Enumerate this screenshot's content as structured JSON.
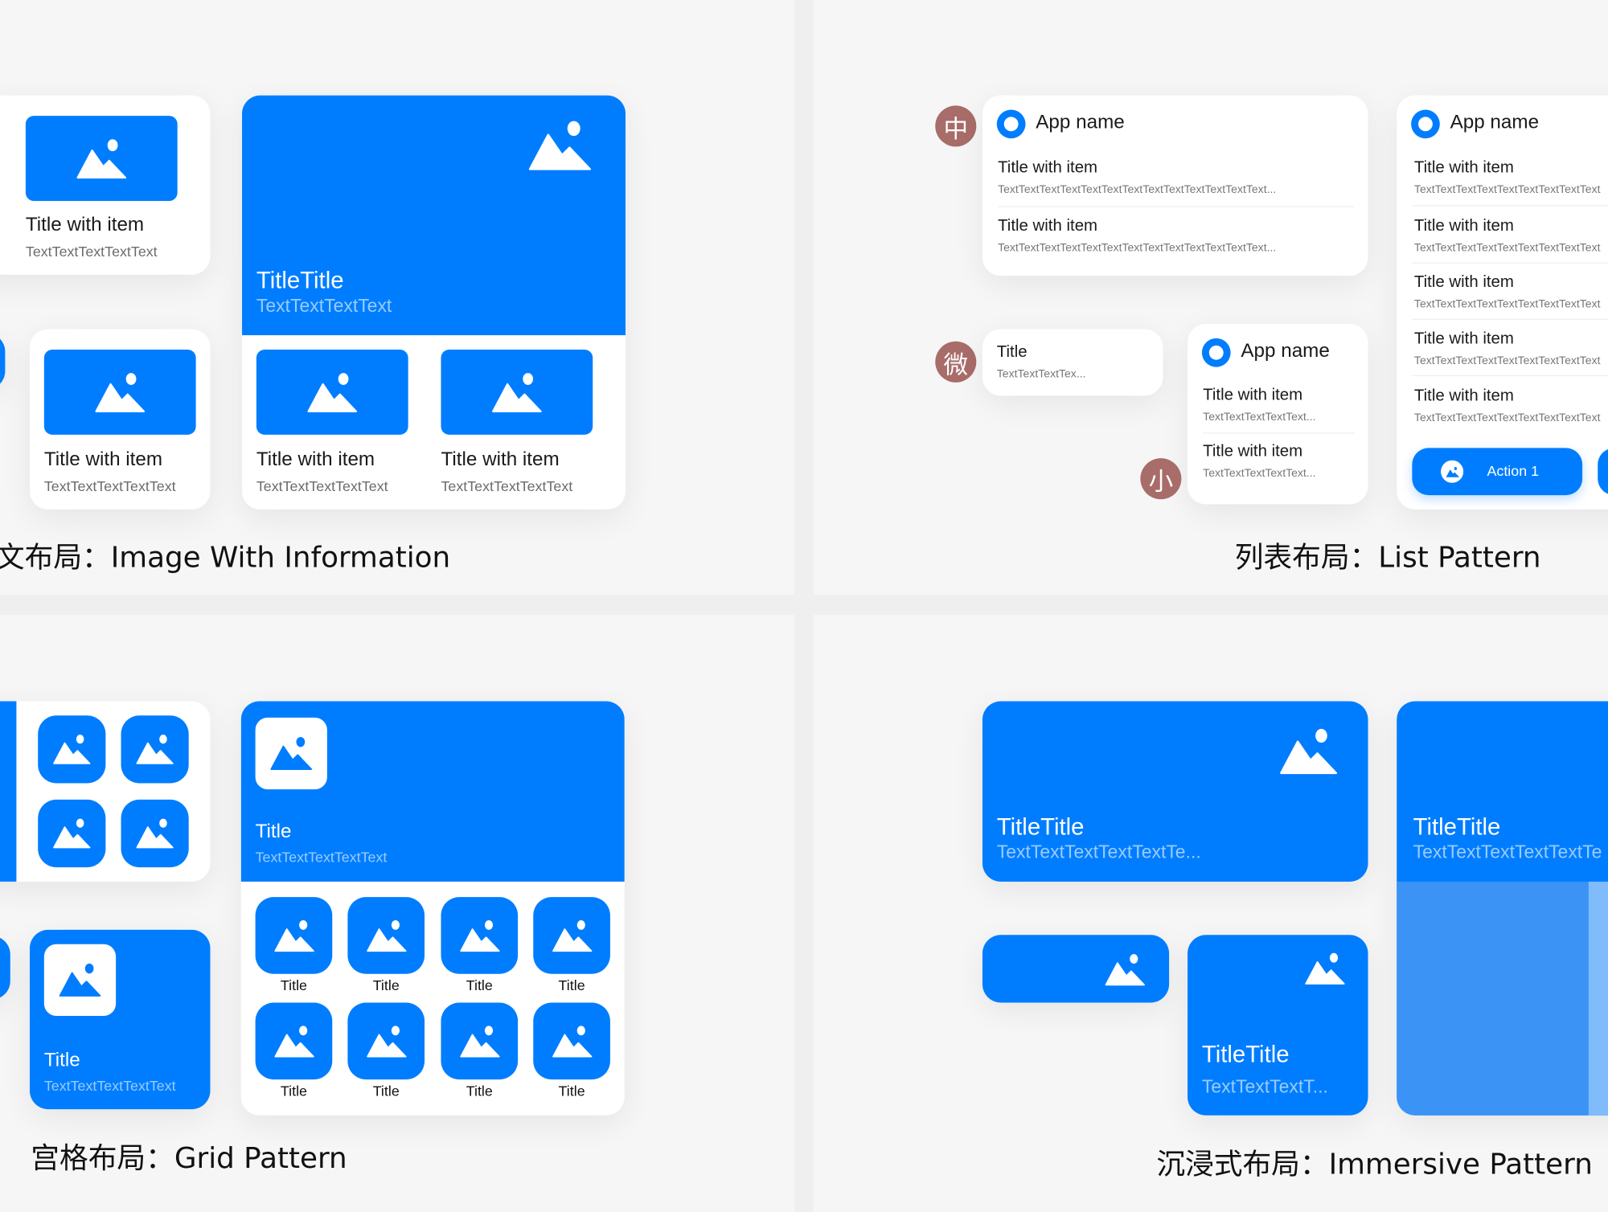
{
  "brand_color": "#007dff",
  "avatar_color": "#a86c69",
  "image_info": {
    "caption": "文布局：Image With Information",
    "card_small_1": {
      "title": "Title with item",
      "text": "TextTextTextTextText"
    },
    "card_small_2": {
      "title": "Title with item",
      "text": "TextTextTextTextText"
    },
    "card_large": {
      "hero_title": "TitleTitle",
      "hero_text": "TextTextTextText",
      "items": [
        {
          "title": "Title with item",
          "text": "TextTextTextTextText"
        },
        {
          "title": "Title with item",
          "text": "TextTextTextTextText"
        }
      ]
    }
  },
  "list": {
    "caption": "列表布局：List Pattern",
    "avatars": [
      "中",
      "微",
      "小"
    ],
    "card_medium": {
      "app_name": "App name",
      "rows": [
        {
          "title": "Title with item",
          "text": "TextTextTextTextTextTextTextTextTextTextTextTextText..."
        },
        {
          "title": "Title with item",
          "text": "TextTextTextTextTextTextTextTextTextTextTextTextText..."
        }
      ]
    },
    "card_mini": {
      "title": "Title",
      "text": "TextTextTextTex..."
    },
    "card_small": {
      "app_name": "App name",
      "rows": [
        {
          "title": "Title with item",
          "text": "TextTextTextTextText..."
        },
        {
          "title": "Title with item",
          "text": "TextTextTextTextText..."
        }
      ]
    },
    "card_large": {
      "app_name": "App name",
      "rows": [
        {
          "title": "Title with item",
          "text": "TextTextTextTextTextTextTextTextText"
        },
        {
          "title": "Title with item",
          "text": "TextTextTextTextTextTextTextTextText"
        },
        {
          "title": "Title with item",
          "text": "TextTextTextTextTextTextTextTextText"
        },
        {
          "title": "Title with item",
          "text": "TextTextTextTextTextTextTextTextText"
        },
        {
          "title": "Title with item",
          "text": "TextTextTextTextTextTextTextTextText"
        }
      ],
      "action_label": "Action 1"
    }
  },
  "grid": {
    "caption": "宫格布局：Grid Pattern",
    "card_small": {
      "title": "Title",
      "text": "TextTextTextTextText"
    },
    "card_large": {
      "title": "Title",
      "text": "TextTextTextTextText",
      "labels": [
        "Title",
        "Title",
        "Title",
        "Title",
        "Title",
        "Title",
        "Title",
        "Title"
      ]
    }
  },
  "immersive": {
    "caption": "沉浸式布局：Immersive Pattern",
    "card_wide": {
      "title": "TitleTitle",
      "text": "TextTextTextTextTextTe..."
    },
    "card_small": {
      "title": "TitleTitle",
      "text": "TextTextTextT..."
    },
    "card_large": {
      "title": "TitleTitle",
      "text": "TextTextTextTextTextTe"
    }
  }
}
